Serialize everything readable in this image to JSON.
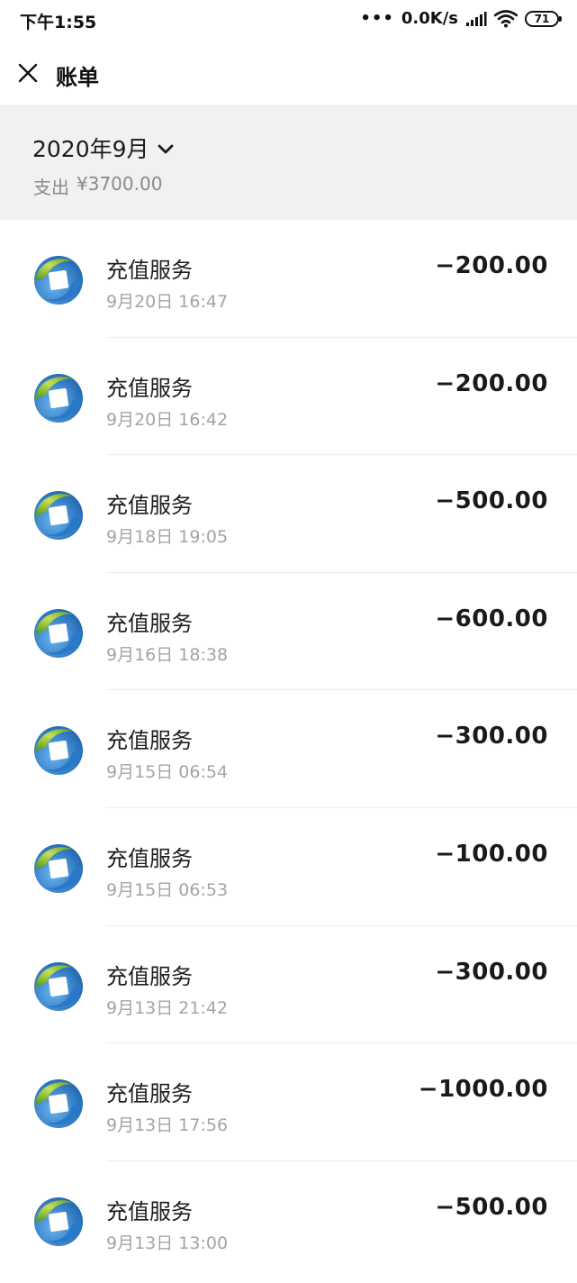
{
  "status_bar": {
    "time": "下午1:55",
    "dots": "•••",
    "network_speed": "0.0K/s",
    "battery": "71",
    "signal_icon": "signal-bars-icon",
    "wifi_icon": "wifi-icon"
  },
  "header": {
    "title": "账单",
    "close_icon": "close-icon"
  },
  "summary": {
    "month": "2020年9月",
    "chevron_icon": "chevron-down-icon",
    "spending_label": "支出",
    "spending_amount": "¥3700.00"
  },
  "colors": {
    "summary_bg": "#f1f1f1",
    "logo_green": "#7fbd2c",
    "logo_blue": "#2f86d6"
  },
  "transactions": [
    {
      "name": "充值服务",
      "time": "9月20日 16:47",
      "amount": "−200.00",
      "icon": "recharge-logo-icon"
    },
    {
      "name": "充值服务",
      "time": "9月20日 16:42",
      "amount": "−200.00",
      "icon": "recharge-logo-icon"
    },
    {
      "name": "充值服务",
      "time": "9月18日 19:05",
      "amount": "−500.00",
      "icon": "recharge-logo-icon"
    },
    {
      "name": "充值服务",
      "time": "9月16日 18:38",
      "amount": "−600.00",
      "icon": "recharge-logo-icon"
    },
    {
      "name": "充值服务",
      "time": "9月15日 06:54",
      "amount": "−300.00",
      "icon": "recharge-logo-icon"
    },
    {
      "name": "充值服务",
      "time": "9月15日 06:53",
      "amount": "−100.00",
      "icon": "recharge-logo-icon"
    },
    {
      "name": "充值服务",
      "time": "9月13日 21:42",
      "amount": "−300.00",
      "icon": "recharge-logo-icon"
    },
    {
      "name": "充值服务",
      "time": "9月13日 17:56",
      "amount": "−1000.00",
      "icon": "recharge-logo-icon"
    },
    {
      "name": "充值服务",
      "time": "9月13日 13:00",
      "amount": "−500.00",
      "icon": "recharge-logo-icon"
    }
  ]
}
